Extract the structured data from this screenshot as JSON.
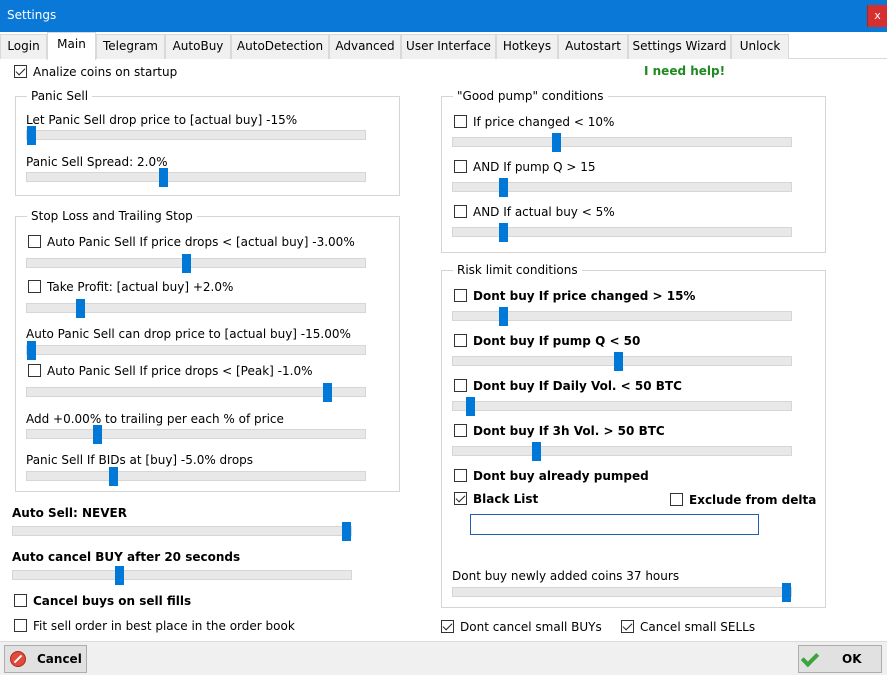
{
  "window": {
    "title": "Settings",
    "close_label": "x"
  },
  "tabs": [
    {
      "label": "Login"
    },
    {
      "label": "Main"
    },
    {
      "label": "Telegram"
    },
    {
      "label": "AutoBuy"
    },
    {
      "label": "AutoDetection"
    },
    {
      "label": "Advanced"
    },
    {
      "label": "User Interface"
    },
    {
      "label": "Hotkeys"
    },
    {
      "label": "Autostart"
    },
    {
      "label": "Settings Wizard"
    },
    {
      "label": "Unlock"
    }
  ],
  "active_tab": "Main",
  "analize": {
    "label": "Analize coins on startup",
    "checked": true
  },
  "help_link": "I need help!",
  "panic_sell": {
    "title": "Panic Sell",
    "drop_label": "Let Panic Sell drop price to [actual buy] -15%",
    "drop_level": 0.0,
    "spread_label": "Panic Sell Spread: 2.0%",
    "spread_level": 0.4
  },
  "stop_loss": {
    "title": "Stop Loss and Trailing Stop",
    "auto_panic_label": "Auto Panic Sell If price drops < [actual buy] -3.00%",
    "auto_panic_checked": false,
    "auto_panic_level": 0.47,
    "take_profit_label": "Take Profit: [actual buy] +2.0%",
    "take_profit_checked": false,
    "take_profit_level": 0.15,
    "can_drop_label": "Auto Panic Sell can drop price to [actual buy] -15.00%",
    "can_drop_level": 0.0,
    "peak_label": "Auto Panic Sell If price drops < [Peak] -1.0%",
    "peak_checked": false,
    "peak_level": 0.9,
    "trailing_label": "Add +0.00% to trailing per each % of price",
    "trailing_level": 0.2,
    "bids_label": "Panic Sell If BIDs  at [buy] -5.0% drops",
    "bids_level": 0.25
  },
  "auto_sell": {
    "label": "Auto Sell: NEVER",
    "level": 1.0
  },
  "auto_cancel": {
    "label": "Auto cancel BUY after 20 seconds",
    "level": 0.31
  },
  "cancel_buys": {
    "label": "Cancel buys on sell fills",
    "checked": false
  },
  "fit_sell": {
    "label": "Fit sell order in best place in the order book",
    "checked": false
  },
  "good_pump": {
    "title": "\"Good pump\" conditions",
    "price_label": "If price changed < 10%",
    "price_checked": false,
    "price_level": 0.3,
    "pump_q_label": "AND If pump Q > 15",
    "pump_q_checked": false,
    "pump_q_level": 0.14,
    "actual_buy_label": "AND If actual buy < 5%",
    "actual_buy_checked": false,
    "actual_buy_level": 0.14
  },
  "risk": {
    "title": "Risk limit conditions",
    "price_label": "Dont buy If price changed > 15%",
    "price_checked": false,
    "price_level": 0.14,
    "pump_q_label": "Dont buy If pump Q < 50",
    "pump_q_checked": false,
    "pump_q_level": 0.49,
    "daily_vol_label": "Dont buy If Daily Vol. < 50 BTC",
    "daily_vol_checked": false,
    "daily_vol_level": 0.04,
    "h3_vol_label": "Dont buy If 3h Vol. > 50 BTC",
    "h3_vol_checked": false,
    "h3_vol_level": 0.24,
    "pumped_label": "Dont buy already pumped",
    "pumped_checked": false,
    "blacklist_label": "Black List",
    "blacklist_checked": true,
    "exclude_label": "Exclude from delta",
    "exclude_checked": false,
    "blacklist_value": "",
    "new_coins_label": "Dont buy newly added coins 37 hours",
    "new_coins_level": 1.0
  },
  "dont_cancel_small_buys": {
    "label": "Dont cancel small BUYs",
    "checked": true
  },
  "cancel_small_sells": {
    "label": "Cancel small SELLs",
    "checked": true
  },
  "buttons": {
    "cancel": "Cancel",
    "ok": "OK"
  }
}
